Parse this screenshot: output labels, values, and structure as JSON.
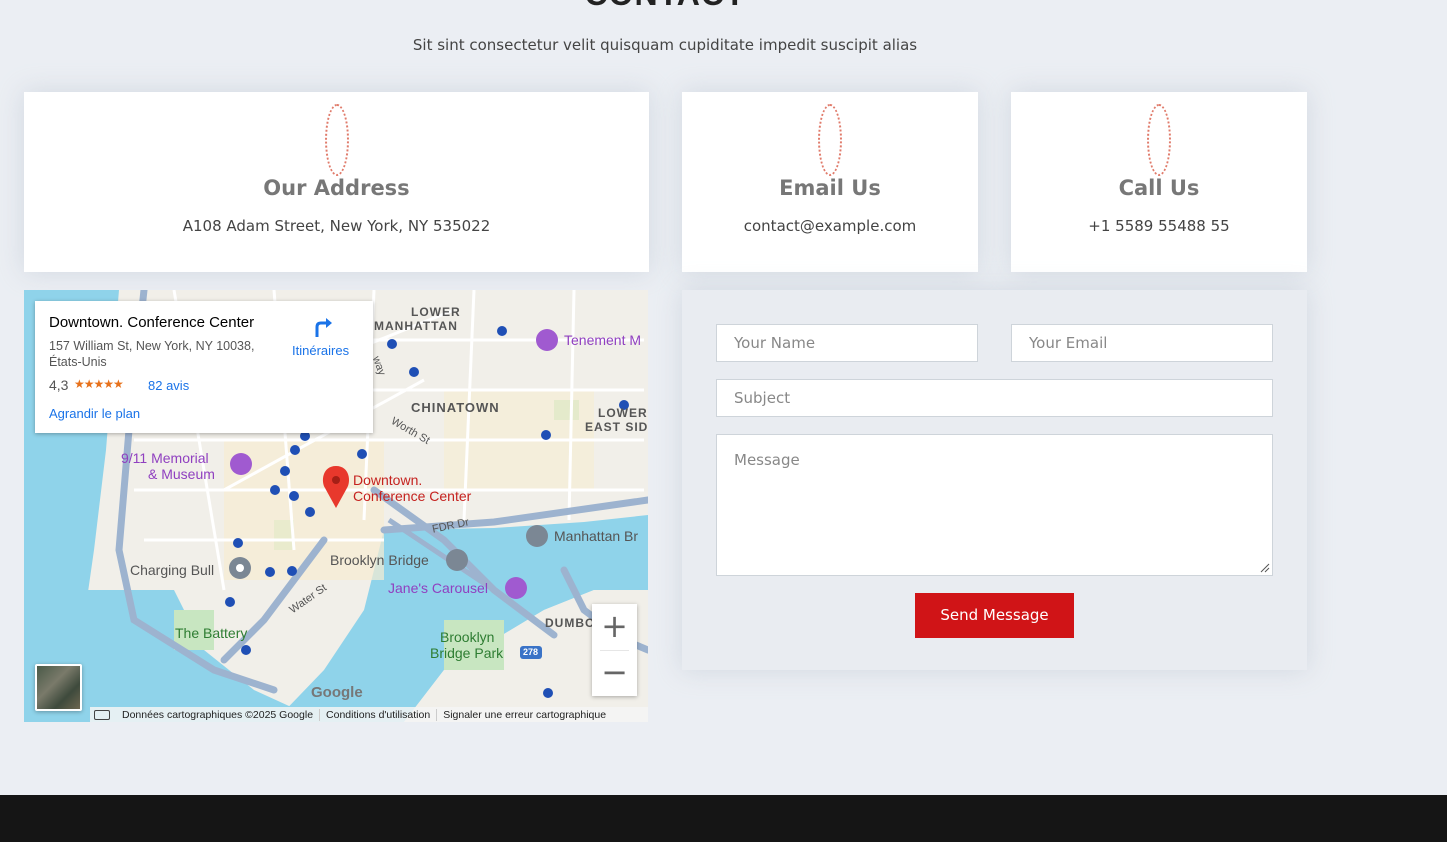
{
  "section": {
    "title": "CONTACT",
    "subtitle": "Sit sint consectetur velit quisquam cupiditate impedit suscipit alias"
  },
  "info": {
    "address": {
      "title": "Our Address",
      "value": "A108 Adam Street, New York, NY 535022",
      "icon": "map-pin-icon"
    },
    "email": {
      "title": "Email Us",
      "value": "contact@example.com",
      "icon": "envelope-icon"
    },
    "phone": {
      "title": "Call Us",
      "value": "+1 5589 55488 55",
      "icon": "phone-icon"
    }
  },
  "map": {
    "card": {
      "name": "Downtown. Conference Center",
      "address": "157 William St, New York, NY 10038, États-Unis",
      "rating": "4,3",
      "stars": "★★★★★",
      "reviews": "82 avis",
      "enlarge": "Agrandir le plan",
      "directions": "Itinéraires"
    },
    "labels": {
      "lower_manhattan_1": "LOWER",
      "lower_manhattan_2": "MANHATTAN",
      "tenement": "Tenement M",
      "chinatown": "CHINATOWN",
      "lower_east_1": "LOWER",
      "lower_east_2": "EAST SID",
      "worth_st": "Worth St",
      "memorial_1": "9/11 Memorial",
      "memorial_2": "& Museum",
      "marker_1": "Downtown.",
      "marker_2": "Conference Center",
      "fdr": "FDR Dr",
      "manhattan_br": "Manhattan Br",
      "brooklyn_bridge": "Brooklyn Bridge",
      "charging_bull": "Charging Bull",
      "janes_carousel": "Jane's Carousel",
      "water_st": "Water St",
      "battery": "The Battery",
      "brooklyn_park_1": "Brooklyn",
      "brooklyn_park_2": "Bridge Park",
      "dumbo": "DUMBO",
      "route": "278",
      "way": "way"
    },
    "zoom_in": "+",
    "zoom_out": "−",
    "google": "Google",
    "footer": {
      "data": "Données cartographiques ©2025 Google",
      "terms": "Conditions d'utilisation",
      "report": "Signaler une erreur cartographique"
    }
  },
  "form": {
    "name_placeholder": "Your Name",
    "email_placeholder": "Your Email",
    "subject_placeholder": "Subject",
    "message_placeholder": "Message",
    "send_label": "Send Message"
  },
  "colors": {
    "accent": "#d01417",
    "link": "#1a73e8",
    "water": "#8fd3ea",
    "park": "#c8e6c1"
  }
}
